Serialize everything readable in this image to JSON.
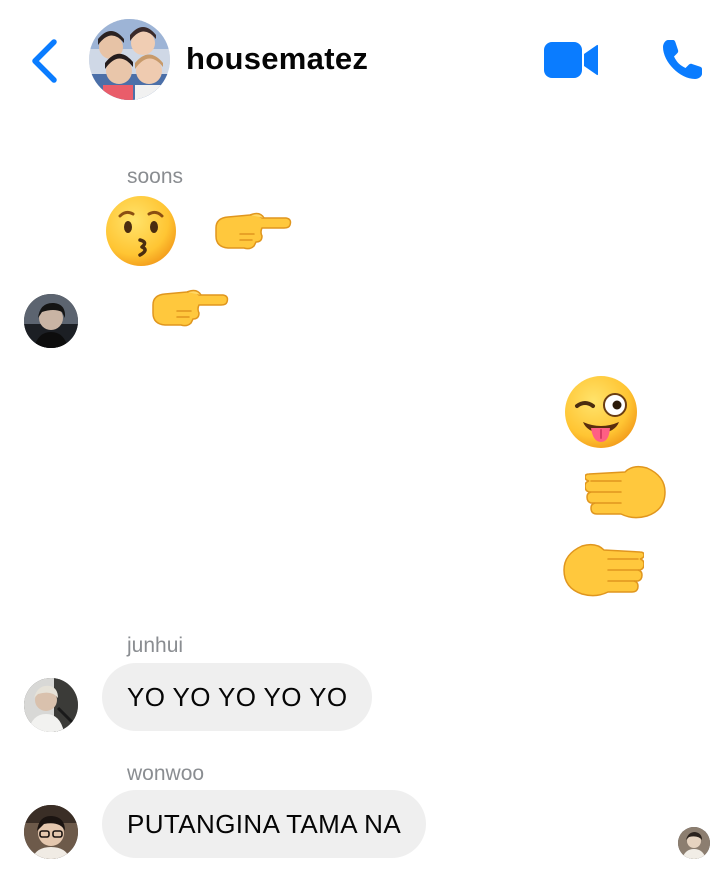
{
  "header": {
    "title": "housematez",
    "accent_color": "#0a7cff",
    "back_icon": "chevron-left-icon",
    "video_icon": "video-camera-icon",
    "call_icon": "phone-icon"
  },
  "messages": [
    {
      "sender": "soons",
      "emojis": [
        "kissing-face",
        "pointing-right",
        "pointing-right"
      ]
    },
    {
      "sender": "me",
      "emojis": [
        "winking-face-with-tongue",
        "hand-pointing-right",
        "hand-pointing-left"
      ]
    },
    {
      "sender": "junhui",
      "text": "YO YO YO YO YO"
    },
    {
      "sender": "wonwoo",
      "text": "PUTANGINA TAMA NA"
    }
  ]
}
